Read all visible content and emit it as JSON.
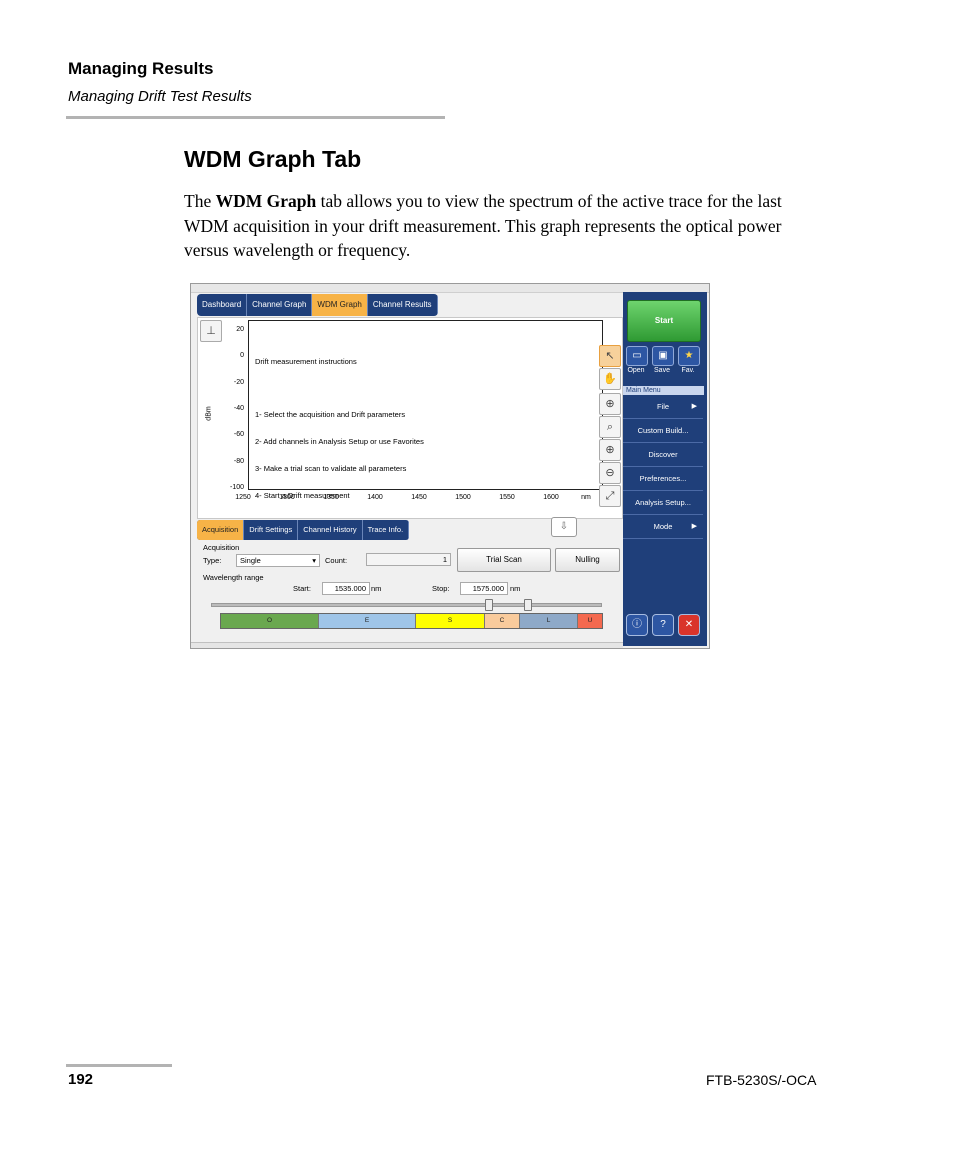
{
  "header": {
    "chapter": "Managing Results",
    "section": "Managing Drift Test Results"
  },
  "section_title": "WDM Graph Tab",
  "body": {
    "part1": "The ",
    "bold": "WDM Graph",
    "part2": " tab allows you to view the spectrum of the active trace for the last WDM acquisition in your drift measurement. This graph represents the optical power versus wavelength or frequency."
  },
  "app": {
    "tabs": [
      "Dashboard",
      "Channel Graph",
      "WDM Graph",
      "Channel Results"
    ],
    "active_tab": "WDM Graph",
    "graph": {
      "y_ticks": [
        "20",
        "0",
        "-20",
        "-40",
        "-60",
        "-80",
        "-100"
      ],
      "x_ticks": [
        "1250",
        "1300",
        "1350",
        "1400",
        "1450",
        "1500",
        "1550",
        "1600"
      ],
      "x_unit": "nm",
      "y_label": "dBm",
      "instructions_title": "Drift measurement instructions",
      "instructions": [
        "1- Select the acquisition and Drift parameters",
        "2- Add channels in Analysis Setup or use Favorites",
        "3- Make a trial scan to validate all parameters",
        "4- Start a Drift measurement"
      ]
    },
    "side": {
      "start": "Start",
      "open": "Open",
      "save": "Save",
      "fav": "Fav.",
      "main_menu": "Main Menu",
      "menu": [
        "File",
        "Custom Build...",
        "Discover",
        "Preferences...",
        "Analysis Setup...",
        "Mode"
      ]
    },
    "panel_tabs": [
      "Acquisition",
      "Drift Settings",
      "Channel History",
      "Trace Info."
    ],
    "acq": {
      "group": "Acquisition",
      "type_label": "Type:",
      "type_value": "Single",
      "count_label": "Count:",
      "count_value": "1",
      "trial_scan": "Trial Scan",
      "nulling": "Nulling",
      "range_label": "Wavelength range",
      "start_label": "Start:",
      "start_value": "1535.000",
      "stop_label": "Stop:",
      "stop_value": "1575.000",
      "unit": "nm",
      "bands": [
        "O",
        "E",
        "S",
        "C",
        "L",
        "U"
      ],
      "band_colors": [
        "#6aa84f",
        "#9fc5e8",
        "#ffff00",
        "#f9cb9c",
        "#8ea9c8",
        "#f4694f"
      ]
    }
  },
  "footer": {
    "page": "192",
    "model": "FTB-5230S/-OCA"
  }
}
